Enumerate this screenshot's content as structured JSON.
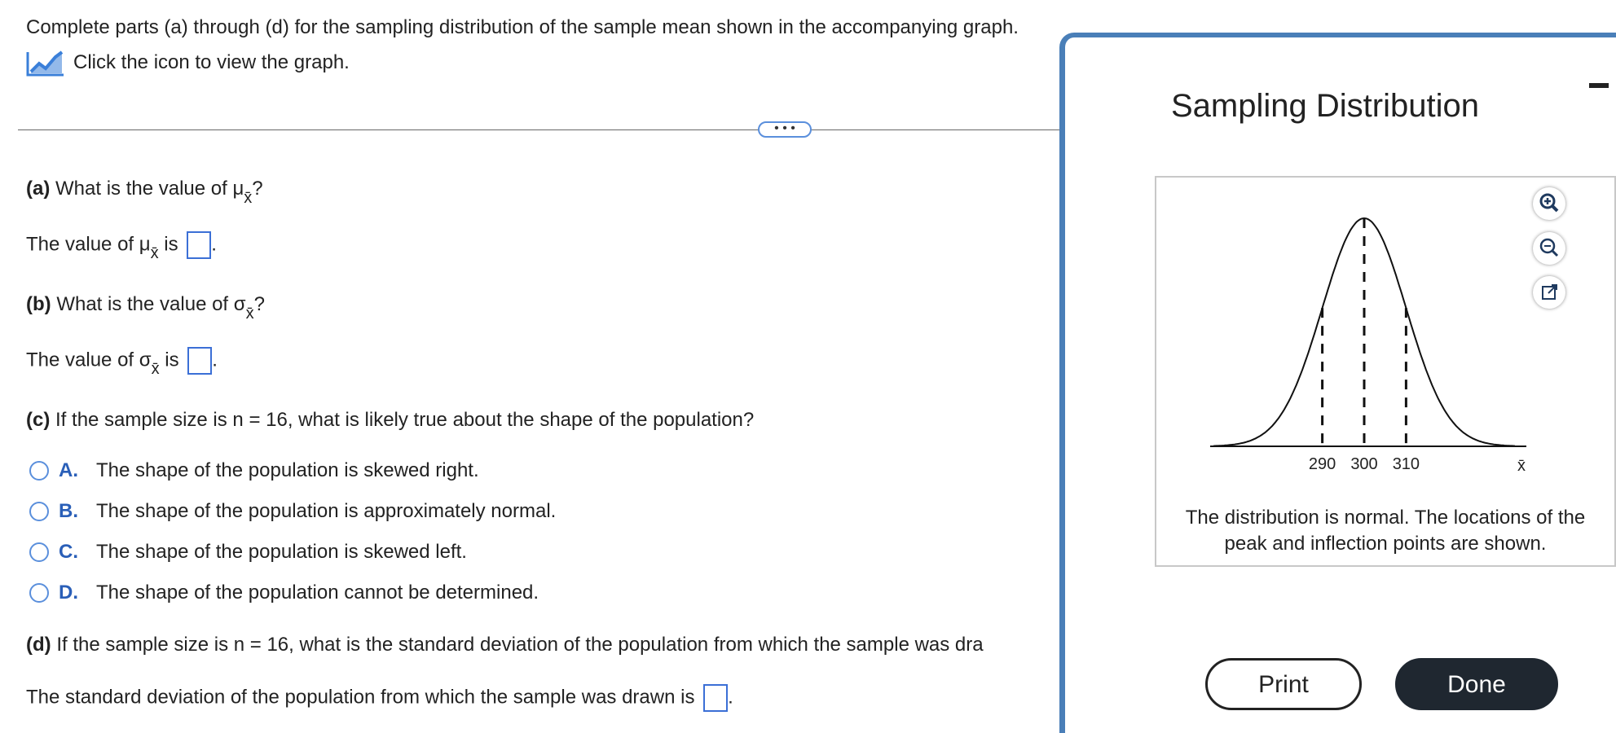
{
  "instructions": "Complete parts (a) through (d) for the sampling distribution of the sample mean shown in the accompanying graph.",
  "graph_link": "Click the icon to view the graph.",
  "more_button": "• • •",
  "part_a": {
    "label": "(a)",
    "question_prefix": "What is the value of μ",
    "sub": "x̄",
    "question_suffix": "?",
    "answer_prefix": "The value of μ",
    "answer_sub": "x̄",
    "answer_mid": "is",
    "answer_end": "."
  },
  "part_b": {
    "label": "(b)",
    "question_prefix": "What is the value of σ",
    "sub": "x̄",
    "question_suffix": "?",
    "answer_prefix": "The value of σ",
    "answer_sub": "x̄",
    "answer_mid": "is",
    "answer_end": "."
  },
  "part_c": {
    "label": "(c)",
    "question": "If the sample size is n = 16, what is likely true about the shape of the population?",
    "options": [
      {
        "letter": "A.",
        "text": "The shape of the population is skewed right."
      },
      {
        "letter": "B.",
        "text": "The shape of the population is approximately normal."
      },
      {
        "letter": "C.",
        "text": "The shape of the population is skewed left."
      },
      {
        "letter": "D.",
        "text": "The shape of the population cannot be determined."
      }
    ]
  },
  "part_d": {
    "label": "(d)",
    "question": "If the sample size is n = 16, what is the standard deviation of the population from which the sample was dra",
    "answer_prefix": "The standard deviation of the population from which the sample was drawn is",
    "answer_end": "."
  },
  "popup": {
    "title": "Sampling Distribution",
    "caption_line1": "The distribution is normal. The locations of the",
    "caption_line2": "peak and inflection points are shown.",
    "print_label": "Print",
    "done_label": "Done",
    "tool_icons": [
      "zoom-in-icon",
      "zoom-out-icon",
      "popout-icon"
    ]
  },
  "chart_data": {
    "type": "line",
    "title": "",
    "xlabel": "x̄",
    "ylabel": "",
    "ticks": [
      290,
      300,
      310
    ],
    "tick_labels": [
      "290",
      "300",
      "310"
    ],
    "mean": 300,
    "sd": 10,
    "marked_points": [
      {
        "x": 290,
        "label": "inflection"
      },
      {
        "x": 300,
        "label": "peak"
      },
      {
        "x": 310,
        "label": "inflection"
      }
    ],
    "xlim": [
      264,
      336
    ]
  }
}
